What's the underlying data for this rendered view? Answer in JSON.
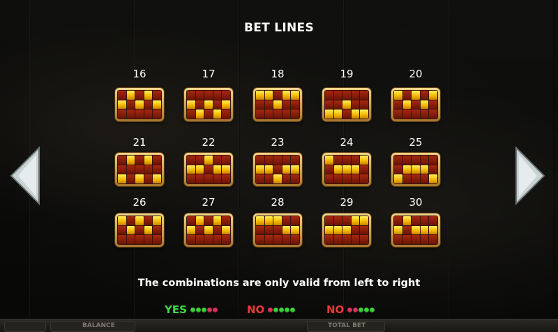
{
  "title": "BET LINES",
  "lines": [
    {
      "number": "16",
      "pattern": [
        [
          0,
          1,
          0,
          1,
          0
        ],
        [
          1,
          0,
          1,
          0,
          1
        ],
        [
          0,
          0,
          0,
          0,
          0
        ]
      ]
    },
    {
      "number": "17",
      "pattern": [
        [
          0,
          0,
          0,
          0,
          0
        ],
        [
          1,
          0,
          1,
          0,
          1
        ],
        [
          0,
          1,
          0,
          1,
          0
        ]
      ]
    },
    {
      "number": "18",
      "pattern": [
        [
          1,
          1,
          0,
          1,
          1
        ],
        [
          0,
          0,
          1,
          0,
          0
        ],
        [
          0,
          0,
          0,
          0,
          0
        ]
      ]
    },
    {
      "number": "19",
      "pattern": [
        [
          0,
          0,
          0,
          0,
          0
        ],
        [
          0,
          0,
          1,
          0,
          0
        ],
        [
          1,
          1,
          0,
          1,
          1
        ]
      ]
    },
    {
      "number": "20",
      "pattern": [
        [
          1,
          0,
          1,
          0,
          1
        ],
        [
          0,
          1,
          0,
          1,
          0
        ],
        [
          0,
          0,
          0,
          0,
          0
        ]
      ]
    },
    {
      "number": "21",
      "pattern": [
        [
          0,
          1,
          0,
          1,
          0
        ],
        [
          0,
          0,
          0,
          0,
          0
        ],
        [
          1,
          0,
          1,
          0,
          1
        ]
      ]
    },
    {
      "number": "22",
      "pattern": [
        [
          0,
          0,
          1,
          0,
          0
        ],
        [
          1,
          1,
          0,
          1,
          1
        ],
        [
          0,
          0,
          0,
          0,
          0
        ]
      ]
    },
    {
      "number": "23",
      "pattern": [
        [
          0,
          0,
          0,
          0,
          0
        ],
        [
          1,
          1,
          0,
          1,
          1
        ],
        [
          0,
          0,
          1,
          0,
          0
        ]
      ]
    },
    {
      "number": "24",
      "pattern": [
        [
          1,
          0,
          0,
          0,
          1
        ],
        [
          0,
          1,
          1,
          1,
          0
        ],
        [
          0,
          0,
          0,
          0,
          0
        ]
      ]
    },
    {
      "number": "25",
      "pattern": [
        [
          0,
          0,
          0,
          0,
          0
        ],
        [
          0,
          1,
          1,
          1,
          0
        ],
        [
          1,
          0,
          0,
          0,
          1
        ]
      ]
    },
    {
      "number": "26",
      "pattern": [
        [
          1,
          0,
          1,
          0,
          1
        ],
        [
          0,
          1,
          0,
          1,
          0
        ],
        [
          0,
          0,
          0,
          0,
          0
        ]
      ]
    },
    {
      "number": "27",
      "pattern": [
        [
          0,
          1,
          0,
          1,
          0
        ],
        [
          1,
          0,
          1,
          0,
          1
        ],
        [
          0,
          0,
          0,
          0,
          0
        ]
      ]
    },
    {
      "number": "28",
      "pattern": [
        [
          1,
          1,
          1,
          0,
          0
        ],
        [
          0,
          0,
          0,
          1,
          1
        ],
        [
          0,
          0,
          0,
          0,
          0
        ]
      ]
    },
    {
      "number": "29",
      "pattern": [
        [
          0,
          0,
          0,
          1,
          1
        ],
        [
          1,
          1,
          1,
          0,
          0
        ],
        [
          0,
          0,
          0,
          0,
          0
        ]
      ]
    },
    {
      "number": "30",
      "pattern": [
        [
          0,
          1,
          0,
          0,
          0
        ],
        [
          1,
          0,
          1,
          1,
          1
        ],
        [
          0,
          0,
          0,
          0,
          0
        ]
      ]
    }
  ],
  "note": "The combinations are only valid from left to right",
  "legend": [
    {
      "label": "YES",
      "color": "#3cdc3c",
      "dots": [
        "green",
        "green",
        "green",
        "red",
        "red"
      ]
    },
    {
      "label": "NO",
      "color": "#e83a3a",
      "dots": [
        "red",
        "green",
        "green",
        "green",
        "green"
      ]
    },
    {
      "label": "NO",
      "color": "#e83a3a",
      "dots": [
        "red",
        "red",
        "green",
        "green",
        "green"
      ]
    }
  ],
  "dot_colors": {
    "green": "#3ad43a",
    "red": "#e0325c"
  },
  "bottom_bar": {
    "balance_label": "BALANCE",
    "total_bet_label": "TOTAL BET"
  },
  "colors": {
    "cell_on": "#f5c400",
    "cell_off": "#8a1e0a",
    "frame": "#d4a550"
  }
}
